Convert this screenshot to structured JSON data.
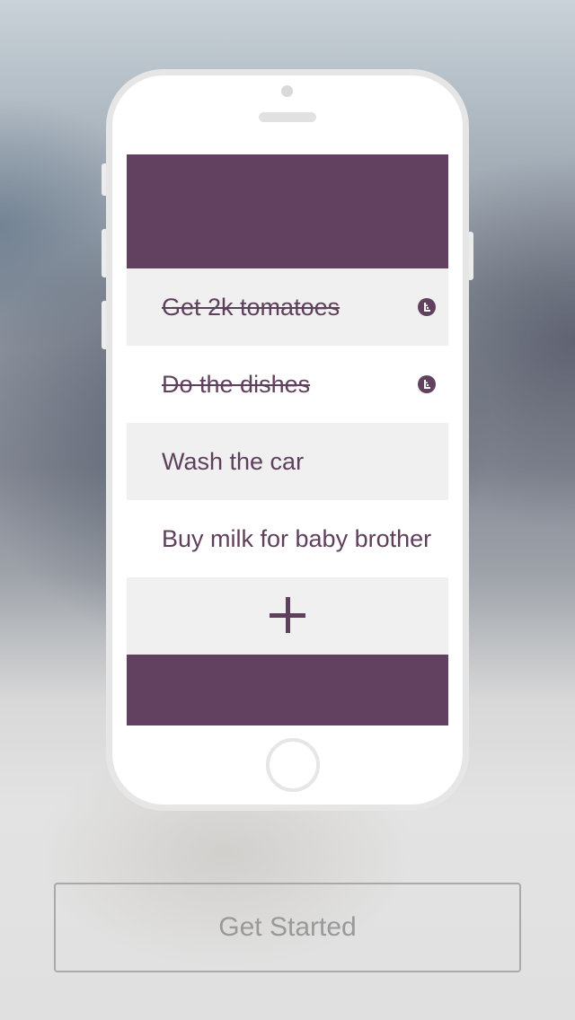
{
  "preview": {
    "todos": [
      {
        "text": "Get 2k tomatoes",
        "completed": true,
        "icon": "info-icon"
      },
      {
        "text": "Do the dishes",
        "completed": true,
        "icon": "info-icon"
      },
      {
        "text": "Wash the car",
        "completed": false
      },
      {
        "text": "Buy milk for baby brother",
        "completed": false
      }
    ],
    "add_button_icon": "plus-icon"
  },
  "cta": {
    "label": "Get Started"
  },
  "colors": {
    "accent": "#62405f",
    "row_gray": "#f0f0f0",
    "text": "#5e3f5c",
    "button_text": "#999999"
  }
}
